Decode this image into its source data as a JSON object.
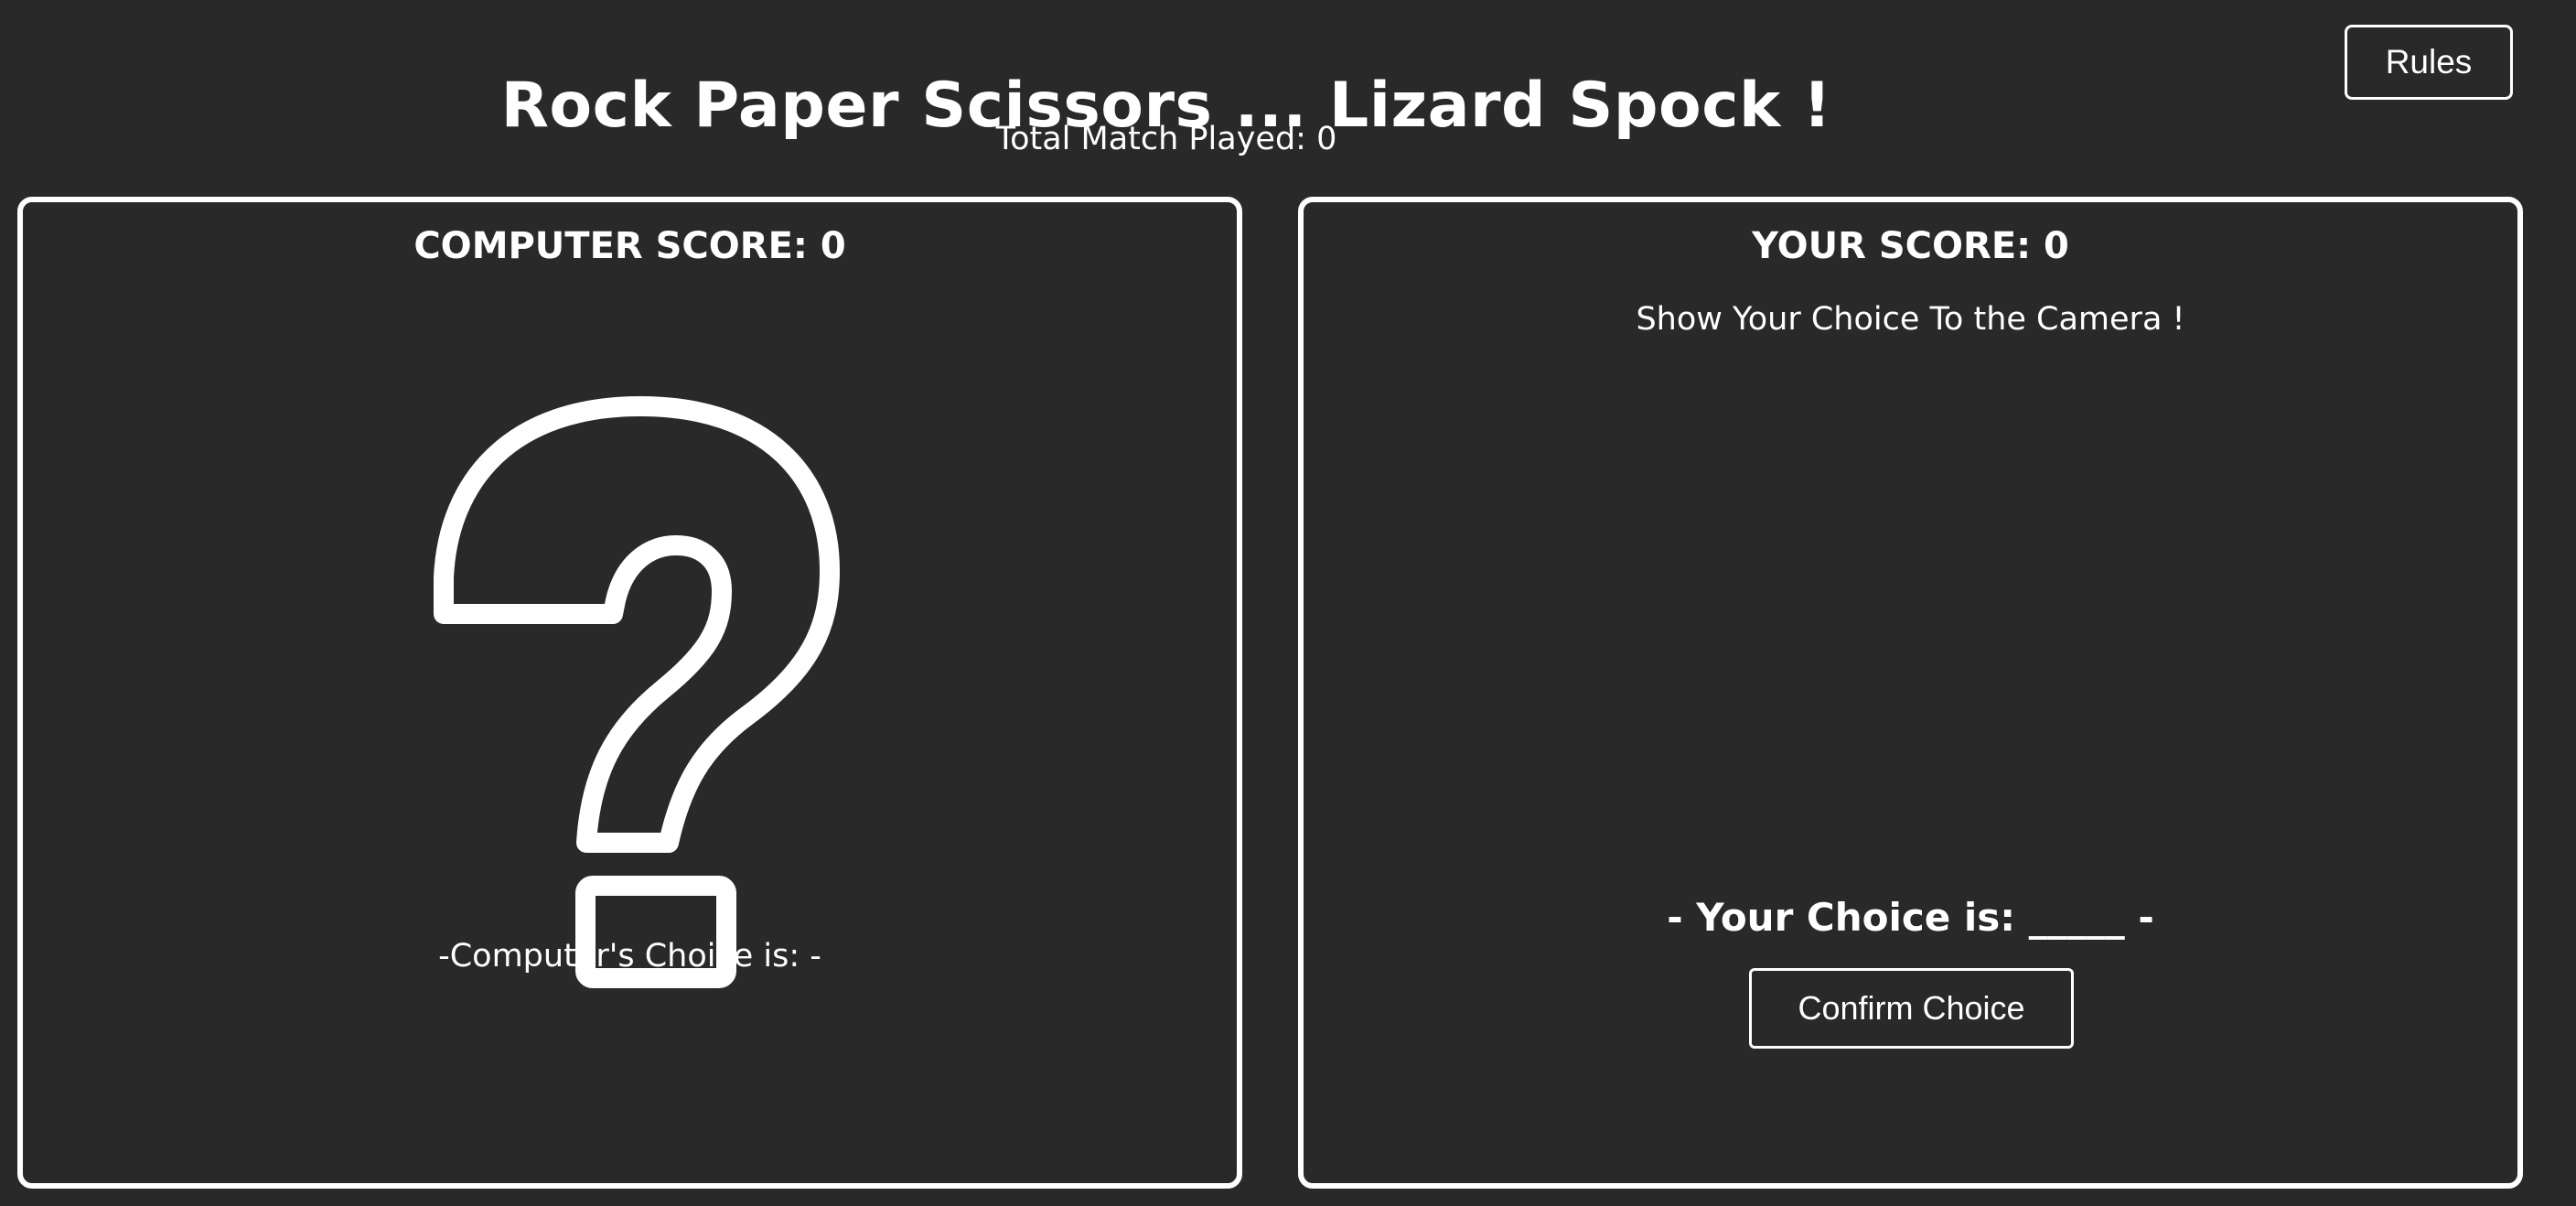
{
  "header": {
    "title": "Rock Paper Scissors ... Lizard Spock !",
    "total_matches": "Total Match Played: 0",
    "rules_label": "Rules"
  },
  "computer_panel": {
    "score_label": "COMPUTER SCORE: 0",
    "choice_icon": "question-mark-icon",
    "choice_text": "-Computer's Choice is: -"
  },
  "player_panel": {
    "score_label": "YOUR SCORE: 0",
    "instruction": "Show Your Choice To the Camera !",
    "choice_text": "- Your Choice is: _____ -",
    "confirm_label": "Confirm Choice"
  },
  "colors": {
    "background": "#292929",
    "foreground": "#ffffff"
  }
}
